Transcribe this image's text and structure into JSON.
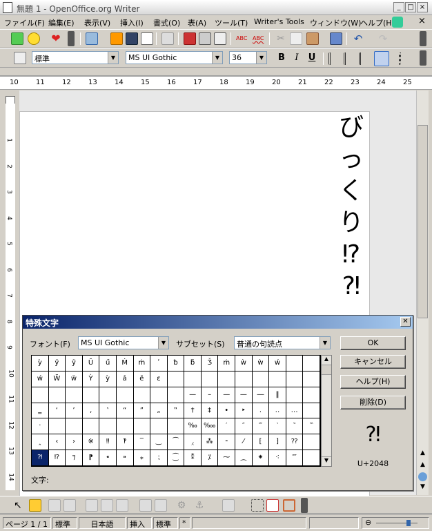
{
  "window": {
    "title": "無題 1 - OpenOffice.org Writer",
    "minimize": "_",
    "maximize": "□",
    "close": "×"
  },
  "menu": [
    "ファイル(F)",
    "編集(E)",
    "表示(V)",
    "挿入(I)",
    "書式(O)",
    "表(A)",
    "ツール(T)",
    "Writer's Tools",
    "ウィンドウ(W)",
    "ヘルプ(H)"
  ],
  "menu_close": "×",
  "format": {
    "style": "標準",
    "font": "MS UI Gothic",
    "size": "36",
    "bold": "B",
    "italic": "I",
    "underline": "U"
  },
  "ruler_ticks": [
    "10",
    "11",
    "12",
    "13",
    "14",
    "15",
    "16",
    "17",
    "18",
    "19",
    "20",
    "21",
    "22",
    "23",
    "24",
    "25"
  ],
  "vruler_ticks": [
    "1",
    "2",
    "3",
    "4",
    "5",
    "6",
    "7",
    "8",
    "9",
    "10",
    "11",
    "12",
    "13",
    "14"
  ],
  "document": {
    "vertical_text": [
      "び",
      "っ",
      "く",
      "り",
      "⁉",
      "⁈"
    ]
  },
  "dialog": {
    "title": "特殊文字",
    "font_label": "フォント(F)",
    "font_value": "MS UI Gothic",
    "subset_label": "サブセット(S)",
    "subset_value": "普通の句読点",
    "chars_label": "文字:",
    "ok": "OK",
    "cancel": "キャンセル",
    "help": "ヘルプ(H)",
    "delete": "削除(D)",
    "preview": "⁈",
    "codepoint": "U+2048",
    "grid": [
      [
        "ä",
        "ǯ",
        "ǯ",
        "Ǧ",
        "ǵ",
        "Ŋ",
        "ŋ",
        "Ō",
        "ǐ",
        "ǒ",
        "ǭ",
        "ǭ",
        "Ÿ",
        "ÿ",
        "Ÿ"
      ],
      [
        "ỳ",
        "ỹ",
        "ỹ",
        "Ū",
        "ű",
        "Ṁ",
        "ṁ",
        "ʹ",
        "ƀ",
        "ƃ",
        "Ǯ",
        "ṁ",
        "ẁ",
        "ẁ",
        "ẃ"
      ],
      [
        "ẃ",
        "Ẅ",
        "ẅ",
        "Ỳ",
        "ỳ",
        "ả",
        "ẽ",
        "ɛ",
        "",
        "",
        "",
        "",
        "",
        "",
        ""
      ],
      [
        "",
        "",
        "",
        "",
        "",
        "",
        "",
        "",
        "",
        "—",
        "–",
        "—",
        "—",
        "―",
        "‖"
      ],
      [
        "‗",
        "‘",
        "’",
        "‚",
        "‛",
        "“",
        "”",
        "„",
        "‟",
        "†",
        "‡",
        "•",
        "‣",
        "․",
        "‥",
        "…"
      ],
      [
        "‧",
        "",
        "",
        "",
        "",
        "",
        "",
        "",
        "",
        "‰",
        "‱",
        "′",
        "″",
        "‴",
        "‵",
        "‶",
        "‷"
      ],
      [
        "‸",
        "‹",
        "›",
        "※",
        "‼",
        "‽",
        "‾",
        "‿",
        "⁀",
        "⁁",
        "⁂",
        "⁃",
        "⁄",
        "⁅",
        "⁆",
        "⁇"
      ],
      [
        "⁈",
        "⁉",
        "⁊",
        "⁋",
        "⁌",
        "⁍",
        "⁎",
        "⁏",
        "⁐",
        "⁑",
        "⁒",
        "⁓",
        "⁔",
        "⁕",
        "⁖",
        "⁗"
      ]
    ]
  },
  "status": {
    "page": "ページ 1 / 1",
    "style": "標準",
    "lang": "日本語",
    "mode": "挿入",
    "sel": "標準",
    "mod": "*"
  },
  "colors": {
    "title_gradient_start": "#0a246a",
    "title_gradient_end": "#a6caf0",
    "selected_cell": "#0a246a"
  }
}
